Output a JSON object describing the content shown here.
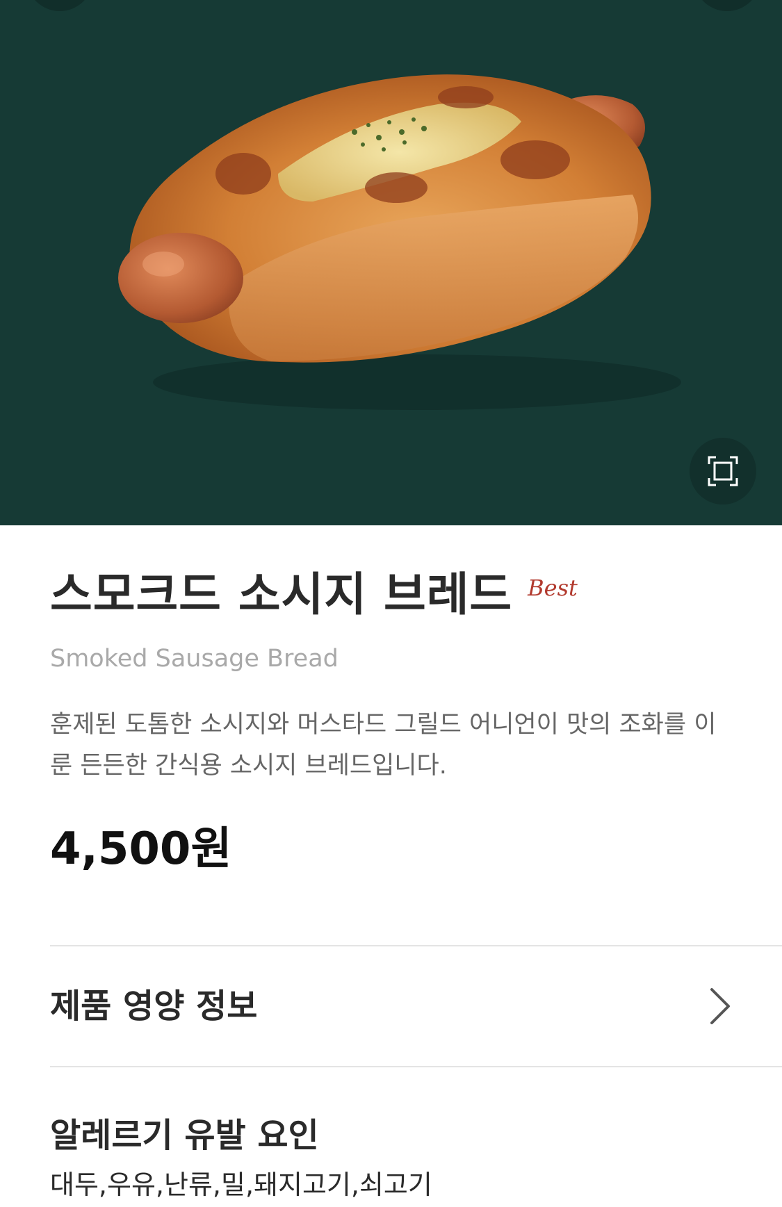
{
  "product": {
    "name_ko": "스모크드 소시지 브레드",
    "badge": "Best",
    "name_en": "Smoked Sausage Bread",
    "description": "훈제된 도톰한 소시지와 머스타드 그릴드 어니언이 맛의 조화를 이룬 든든한 간식용 소시지 브레드입니다.",
    "price": "4,500원"
  },
  "sections": {
    "nutrition_label": "제품 영양 정보",
    "allergy_title": "알레르기 유발 요인",
    "allergy_list": "대두,우유,난류,밀,돼지고기,쇠고기"
  },
  "icons": {
    "expand": "expand-icon",
    "chevron": "chevron-right-icon"
  },
  "colors": {
    "hero_background": "#163a35",
    "badge": "#b23a2e",
    "subtitle": "#a9a9a9",
    "description": "#666666"
  }
}
